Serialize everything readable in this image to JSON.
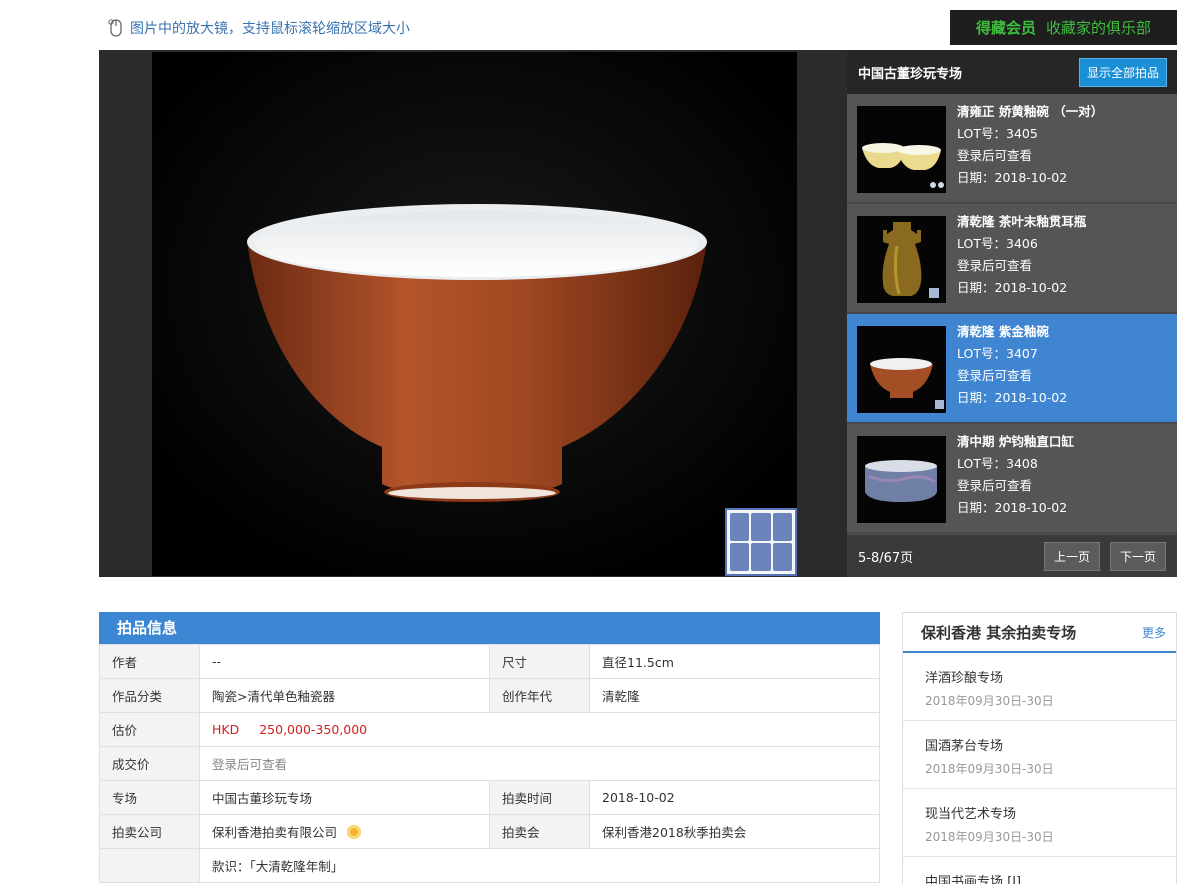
{
  "hint": "图片中的放大镜，支持鼠标滚轮缩放区域大小",
  "vip": {
    "title": "得藏会员",
    "subtitle": "收藏家的俱乐部"
  },
  "sidebar": {
    "title": "中国古董珍玩专场",
    "show_all": "显示全部拍品",
    "lots": [
      {
        "name": "清雍正 娇黄釉碗 （一对）",
        "lot": "LOT号：3405",
        "price": "登录后可查看",
        "date": "日期：2018-10-02"
      },
      {
        "name": "清乾隆 茶叶末釉贯耳瓶",
        "lot": "LOT号：3406",
        "price": "登录后可查看",
        "date": "日期：2018-10-02"
      },
      {
        "name": "清乾隆 紫金釉碗",
        "lot": "LOT号：3407",
        "price": "登录后可查看",
        "date": "日期：2018-10-02"
      },
      {
        "name": "清中期 炉钧釉直口缸",
        "lot": "LOT号：3408",
        "price": "登录后可查看",
        "date": "日期：2018-10-02"
      }
    ],
    "page_info": "5-8/67页",
    "prev": "上一页",
    "next": "下一页"
  },
  "lotinfo": {
    "header": "拍品信息",
    "author_k": "作者",
    "author_v": "--",
    "size_k": "尺寸",
    "size_v": "直径11.5cm",
    "cat_k": "作品分类",
    "cat_v": "陶瓷>清代单色釉瓷器",
    "era_k": "创作年代",
    "era_v": "清乾隆",
    "est_k": "估价",
    "est_cur": "HKD",
    "est_v": "250,000-350,000",
    "deal_k": "成交价",
    "deal_v": "登录后可查看",
    "session_k": "专场",
    "session_v": "中国古董珍玩专场",
    "time_k": "拍卖时间",
    "time_v": "2018-10-02",
    "company_k": "拍卖公司",
    "company_v": "保利香港拍卖有限公司",
    "sale_k": "拍卖会",
    "sale_v": "保利香港2018秋季拍卖会",
    "desc_v": "款识：「大清乾隆年制」"
  },
  "others": {
    "title": "保利香港 其余拍卖专场",
    "more": "更多",
    "items": [
      {
        "name": "洋酒珍酿专场",
        "date": "2018年09月30日-30日"
      },
      {
        "name": "国酒茅台专场",
        "date": "2018年09月30日-30日"
      },
      {
        "name": "现当代艺术专场",
        "date": "2018年09月30日-30日"
      },
      {
        "name": "中国书画专场 [I]",
        "date": ""
      }
    ]
  }
}
